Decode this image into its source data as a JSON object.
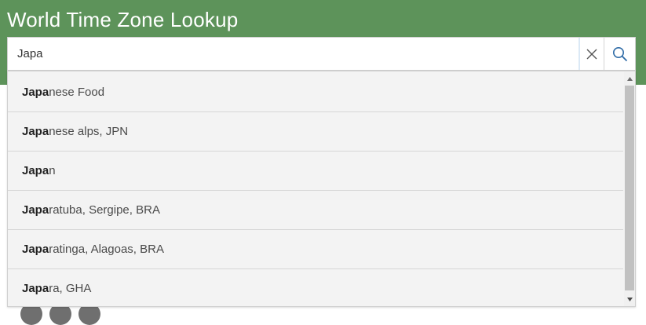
{
  "app": {
    "title": "World Time Zone Lookup"
  },
  "search": {
    "value": "Japa",
    "clear_icon": "close-icon",
    "search_icon": "search-icon"
  },
  "suggestions": [
    {
      "match": "Japa",
      "rest": "nese Food"
    },
    {
      "match": "Japa",
      "rest": "nese alps, JPN"
    },
    {
      "match": "Japa",
      "rest": "n"
    },
    {
      "match": "Japa",
      "rest": "ratuba, Sergipe, BRA"
    },
    {
      "match": "Japa",
      "rest": "ratinga, Alagoas, BRA"
    },
    {
      "match": "Japa",
      "rest": "ra, GHA"
    }
  ],
  "colors": {
    "header": "#5d935a",
    "menu_background": "#f3f3f3",
    "accent_icon": "#2e6ba6"
  }
}
